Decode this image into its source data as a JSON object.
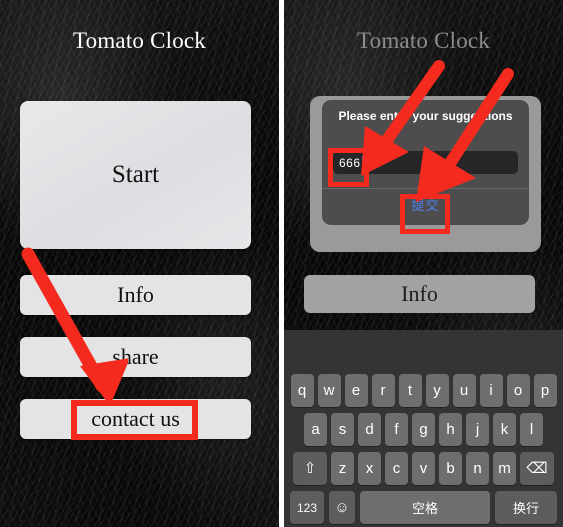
{
  "app": {
    "title": "Tomato Clock"
  },
  "left_panel": {
    "title": "Tomato Clock",
    "buttons": [
      {
        "label": "Start"
      },
      {
        "label": "Info"
      },
      {
        "label": "share"
      },
      {
        "label": "contact us"
      }
    ],
    "annotation": {
      "highlight_target": "contact us",
      "arrow_color": "#f52a1e"
    }
  },
  "right_panel": {
    "title": "Tomato Clock",
    "dialog": {
      "title": "Please enter your suggestions",
      "input_value": "666",
      "input_placeholder": "",
      "submit_label": "提交"
    },
    "buttons": [
      {
        "label": "Info"
      }
    ],
    "annotations": {
      "highlight_input": "666",
      "highlight_submit": "提交",
      "arrow_color": "#f52a1e"
    },
    "keyboard": {
      "row1": [
        "q",
        "w",
        "e",
        "r",
        "t",
        "y",
        "u",
        "i",
        "o",
        "p"
      ],
      "row2": [
        "a",
        "s",
        "d",
        "f",
        "g",
        "h",
        "j",
        "k",
        "l"
      ],
      "row3": [
        "z",
        "x",
        "c",
        "v",
        "b",
        "n",
        "m"
      ],
      "shift_label": "⇧",
      "backspace_label": "⌫",
      "numeric_label": "123",
      "emoji_label": "☺",
      "space_label": "空格",
      "return_label": "换行"
    }
  },
  "colors": {
    "background": "#0a0a0a",
    "button_face": "#e4e3e6",
    "annotation_red": "#f52a1e",
    "submit_blue": "#4f7ff0",
    "caret_blue": "#3478f6"
  }
}
